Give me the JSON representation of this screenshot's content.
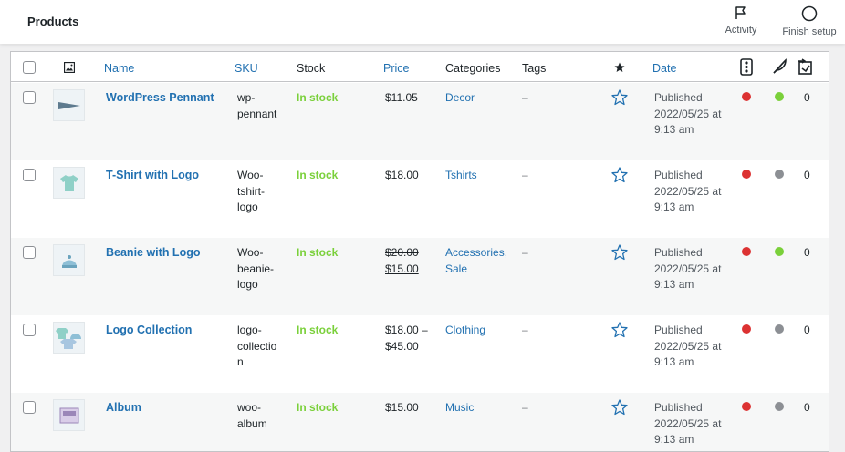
{
  "topbar": {
    "title": "Products",
    "activity_label": "Activity",
    "finish_label": "Finish setup"
  },
  "columns": {
    "name": "Name",
    "sku": "SKU",
    "stock": "Stock",
    "price": "Price",
    "categories": "Categories",
    "tags": "Tags",
    "date": "Date"
  },
  "products": [
    {
      "name": "WordPress Pennant",
      "sku": [
        "wp-",
        "pennant"
      ],
      "stock": "In stock",
      "price": [
        "$11.05"
      ],
      "categories": [
        "Decor"
      ],
      "tags": "–",
      "date": [
        "Published",
        "2022/05/25 at",
        "9:13 am"
      ],
      "status1": "red",
      "status2": "green",
      "count": "0"
    },
    {
      "name": "T-Shirt with Logo",
      "sku": [
        "Woo-",
        "tshirt-",
        "logo"
      ],
      "stock": "In stock",
      "price": [
        "$18.00"
      ],
      "categories": [
        "Tshirts"
      ],
      "tags": "–",
      "date": [
        "Published",
        "2022/05/25 at",
        "9:13 am"
      ],
      "status1": "red",
      "status2": "grey",
      "count": "0"
    },
    {
      "name": "Beanie with Logo",
      "sku": [
        "Woo-",
        "beanie-",
        "logo"
      ],
      "stock": "In stock",
      "price_old": "$20.00",
      "price": [
        "$15.00"
      ],
      "categories": [
        "Accessories,",
        "Sale"
      ],
      "tags": "–",
      "date": [
        "Published",
        "2022/05/25 at",
        "9:13 am"
      ],
      "status1": "red",
      "status2": "green",
      "count": "0"
    },
    {
      "name": "Logo Collection",
      "sku": [
        "logo-",
        "collectio",
        "n"
      ],
      "stock": "In stock",
      "price": [
        "$18.00 –",
        "$45.00"
      ],
      "categories": [
        "Clothing"
      ],
      "tags": "–",
      "date": [
        "Published",
        "2022/05/25 at",
        "9:13 am"
      ],
      "status1": "red",
      "status2": "grey",
      "count": "0"
    },
    {
      "name": "Album",
      "sku": [
        "woo-",
        "album"
      ],
      "stock": "In stock",
      "price": [
        "$15.00"
      ],
      "categories": [
        "Music"
      ],
      "tags": "–",
      "date": [
        "Published",
        "2022/05/25 at",
        "9:13 am"
      ],
      "status1": "red",
      "status2": "grey",
      "count": "0"
    }
  ],
  "colors": {
    "link": "#2271b1",
    "in_stock": "#7ad03a",
    "red": "#dc3232",
    "green": "#7ad03a",
    "grey": "#8c8f94"
  }
}
